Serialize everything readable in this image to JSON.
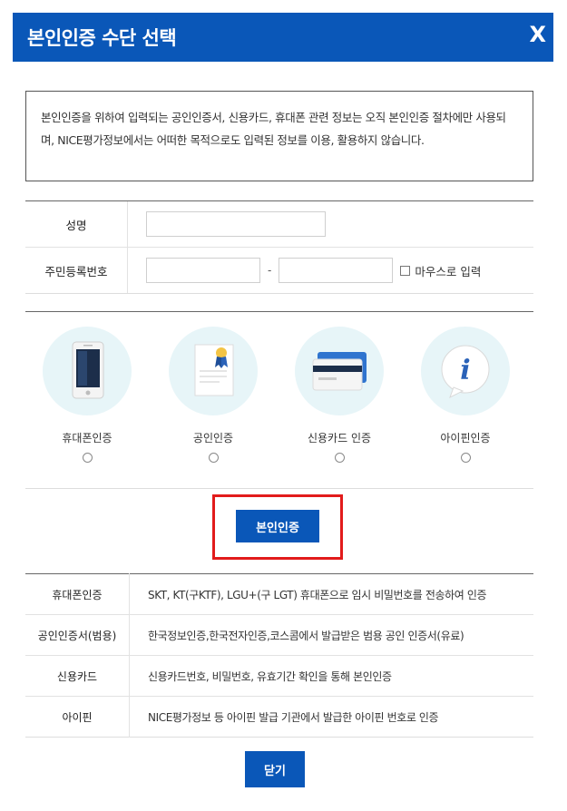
{
  "header": {
    "title": "본인인증 수단 선택",
    "close_label": "X"
  },
  "notice": {
    "text": "본인인증을 위하여 입력되는 공인인증서, 신용카드, 휴대폰 관련 정보는 오직 본인인증 절차에만 사용되며, NICE평가정보에서는 어떠한 목적으로도 입력된 정보를 이용, 활용하지 않습니다."
  },
  "form": {
    "name_label": "성명",
    "rrn_label": "주민등록번호",
    "dash": "-",
    "mouse_input_label": "마우스로 입력"
  },
  "methods": [
    {
      "label": "휴대폰인증",
      "icon": "phone-icon"
    },
    {
      "label": "공인인증",
      "icon": "certificate-icon"
    },
    {
      "label": "신용카드 인증",
      "icon": "credit-card-icon"
    },
    {
      "label": "아이핀인증",
      "icon": "ipin-info-icon"
    }
  ],
  "confirm_button": "본인인증",
  "info_table": [
    {
      "key": "휴대폰인증",
      "value": "SKT, KT(구KTF), LGU+(구 LGT) 휴대폰으로 임시 비밀번호를 전송하여 인증"
    },
    {
      "key": "공인인증서(범용)",
      "value": "한국정보인증,한국전자인증,코스콤에서 발급받은 범용 공인 인증서(유료)"
    },
    {
      "key": "신용카드",
      "value": "신용카드번호, 비밀번호, 유효기간 확인을 통해 본인인증"
    },
    {
      "key": "아이핀",
      "value": "NICE평가정보 등 아이핀 발급 기관에서 발급한 아이핀 번호로 인증"
    }
  ],
  "close_button": "닫기",
  "colors": {
    "primary": "#0a57b8",
    "highlight": "#e21b1b",
    "icon_bg": "#e7f5f8"
  }
}
